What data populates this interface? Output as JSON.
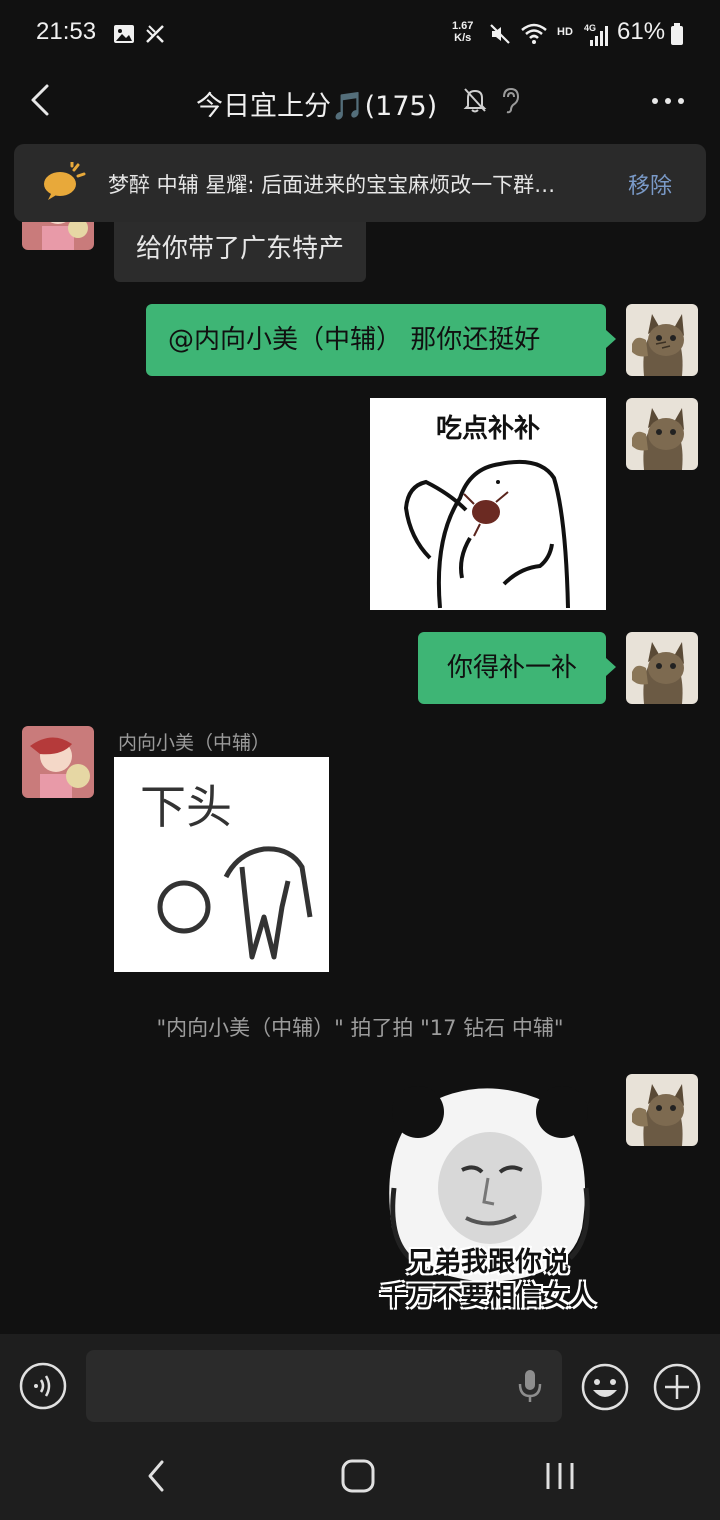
{
  "status_bar": {
    "time": "21:53",
    "net_speed_value": "1.67",
    "net_speed_unit": "K/s",
    "hd_label": "HD",
    "network_type": "4G",
    "battery": "61%"
  },
  "header": {
    "title": "今日宜上分🎵(175)"
  },
  "notice": {
    "text": "梦醉 中辅 星耀: 后面进来的宝宝麻烦改一下群…",
    "remove_label": "移除"
  },
  "messages": {
    "m1_text": "给你带了广东特产",
    "m2_text": "@内向小美（中辅） 那你还挺好",
    "m3_sticker_caption": "吃点补补",
    "m4_text": "你得补一补",
    "m5_sender": "内向小美（中辅）",
    "m5_sticker_caption": "下头",
    "system_msg": "\"内向小美（中辅）\" 拍了拍 \"17 钻石 中辅\"",
    "m6_sticker_caption_line1": "兄弟我跟你说",
    "m6_sticker_caption_line2": "千万不要相信女人"
  },
  "input_bar": {
    "placeholder": ""
  },
  "colors": {
    "background": "#111111",
    "bubble_self": "#3eb575",
    "bubble_other": "#2c2c2c",
    "notice_remove": "#7a9ac8"
  },
  "icons": [
    "gallery-icon",
    "no-sim-icon",
    "mute-icon",
    "wifi-icon",
    "signal-icon",
    "battery-icon",
    "back-icon",
    "ear-icon",
    "more-icon",
    "announcement-icon",
    "voice-icon",
    "mic-icon",
    "emoji-icon",
    "plus-icon",
    "nav-back-icon",
    "nav-home-icon",
    "nav-recents-icon"
  ]
}
